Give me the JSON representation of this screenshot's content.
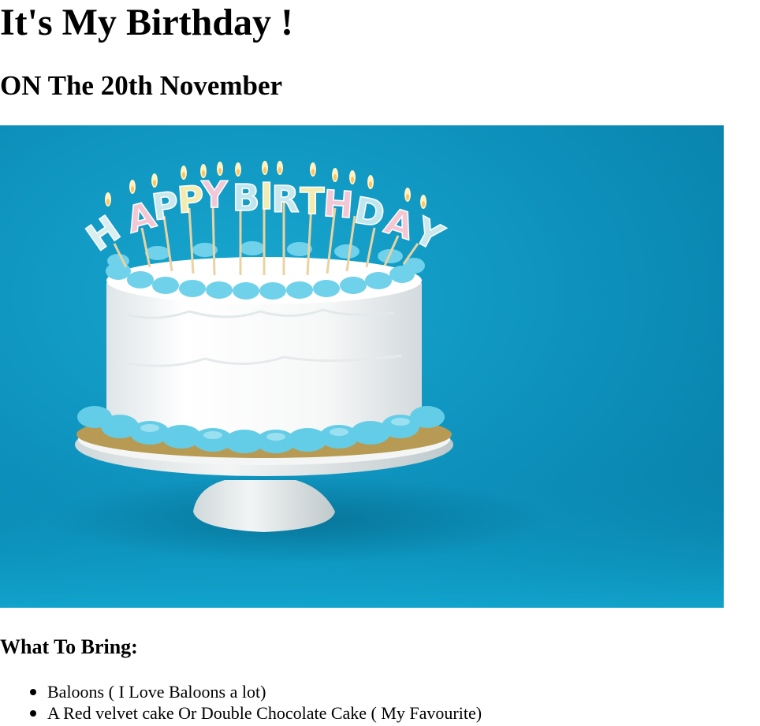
{
  "page": {
    "title": "It's My Birthday !",
    "subtitle": "ON The 20th November"
  },
  "hero_image": {
    "depicts": "cake-image",
    "candle_letters": [
      "H",
      "A",
      "P",
      "P",
      "Y",
      "B",
      "I",
      "R",
      "T",
      "H",
      "D",
      "A",
      "Y"
    ]
  },
  "section": {
    "heading": "What To Bring:",
    "items": [
      {
        "label": "Baloons ( I Love Baloons a lot)"
      },
      {
        "label": "A Red velvet cake Or Double Chocolate Cake ( My Favourite)"
      }
    ]
  },
  "colors": {
    "background": "#0f9bc5",
    "frosting": "#f7f8f8",
    "trim": "#62cbe6",
    "stand": "#e8ecec"
  }
}
